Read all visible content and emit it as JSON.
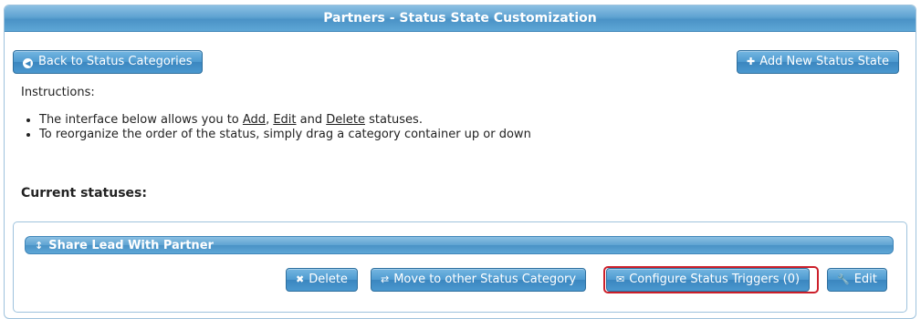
{
  "panel": {
    "title": "Partners - Status State Customization"
  },
  "toolbar": {
    "back_label": "Back to Status Categories",
    "add_label": "Add New Status State"
  },
  "instructions": {
    "label": "Instructions:",
    "line1_prefix": "The interface below allows you to ",
    "add": "Add",
    "sep1": ", ",
    "edit": "Edit",
    "sep2": " and ",
    "delete": "Delete",
    "line1_suffix": " statuses.",
    "line2": "To reorganize the order of the status, simply drag a category container up or down"
  },
  "statuses": {
    "heading": "Current statuses:",
    "items": [
      {
        "name": "Share Lead With Partner",
        "delete_label": "Delete",
        "move_label": "Move to other Status Category",
        "triggers_label": "Configure Status Triggers (0)",
        "edit_label": "Edit"
      }
    ]
  },
  "colors": {
    "accent": "#4a92c6",
    "highlight": "#cc1f2a"
  }
}
